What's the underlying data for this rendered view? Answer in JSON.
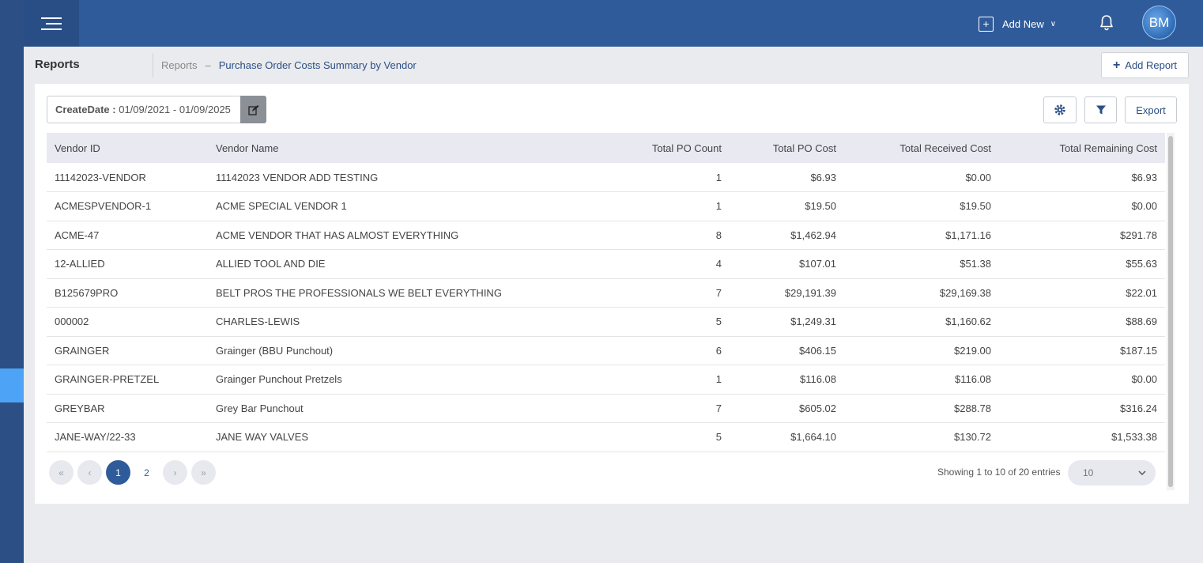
{
  "header": {
    "add_new_label": "Add New",
    "avatar_initials": "BM"
  },
  "subheader": {
    "title": "Reports",
    "breadcrumb_root": "Reports",
    "breadcrumb_sep": "–",
    "breadcrumb_current": "Purchase Order Costs Summary by Vendor",
    "add_report_label": "Add Report"
  },
  "filters": {
    "date_label": "CreateDate :",
    "date_value": "01/09/2021 - 01/09/2025"
  },
  "toolbar": {
    "export_label": "Export"
  },
  "table": {
    "columns": [
      "Vendor ID",
      "Vendor Name",
      "Total PO Count",
      "Total PO Cost",
      "Total Received Cost",
      "Total Remaining Cost"
    ],
    "rows": [
      [
        "11142023-VENDOR",
        "11142023 VENDOR ADD TESTING",
        "1",
        "$6.93",
        "$0.00",
        "$6.93"
      ],
      [
        "ACMESPVENDOR-1",
        "ACME SPECIAL VENDOR 1",
        "1",
        "$19.50",
        "$19.50",
        "$0.00"
      ],
      [
        "ACME-47",
        "ACME VENDOR THAT HAS ALMOST EVERYTHING",
        "8",
        "$1,462.94",
        "$1,171.16",
        "$291.78"
      ],
      [
        "12-ALLIED",
        "ALLIED TOOL AND DIE",
        "4",
        "$107.01",
        "$51.38",
        "$55.63"
      ],
      [
        "B125679PRO",
        "BELT PROS THE PROFESSIONALS WE BELT EVERYTHING",
        "7",
        "$29,191.39",
        "$29,169.38",
        "$22.01"
      ],
      [
        "000002",
        "CHARLES-LEWIS",
        "5",
        "$1,249.31",
        "$1,160.62",
        "$88.69"
      ],
      [
        "GRAINGER",
        "Grainger (BBU Punchout)",
        "6",
        "$406.15",
        "$219.00",
        "$187.15"
      ],
      [
        "GRAINGER-PRETZEL",
        "Grainger Punchout Pretzels",
        "1",
        "$116.08",
        "$116.08",
        "$0.00"
      ],
      [
        "GREYBAR",
        "Grey Bar Punchout",
        "7",
        "$605.02",
        "$288.78",
        "$316.24"
      ],
      [
        "JANE-WAY/22-33",
        "JANE WAY VALVES",
        "5",
        "$1,664.10",
        "$130.72",
        "$1,533.38"
      ]
    ]
  },
  "pagination": {
    "pages": [
      "1",
      "2"
    ],
    "current_page": "1",
    "showing_text": "Showing 1 to 10 of 20 entries",
    "page_size": "10"
  },
  "icons": {
    "menu": "hamburger-icon",
    "add_new": "plus-square-icon",
    "notifications": "bell-icon",
    "edit": "edit-icon",
    "settings": "gear-icon",
    "filter": "funnel-icon"
  },
  "colors": {
    "topbar": "#2f5b9a",
    "left_rail": "#2c4f85",
    "accent": "#2c4f85",
    "active_page": "#2f5b9a"
  }
}
